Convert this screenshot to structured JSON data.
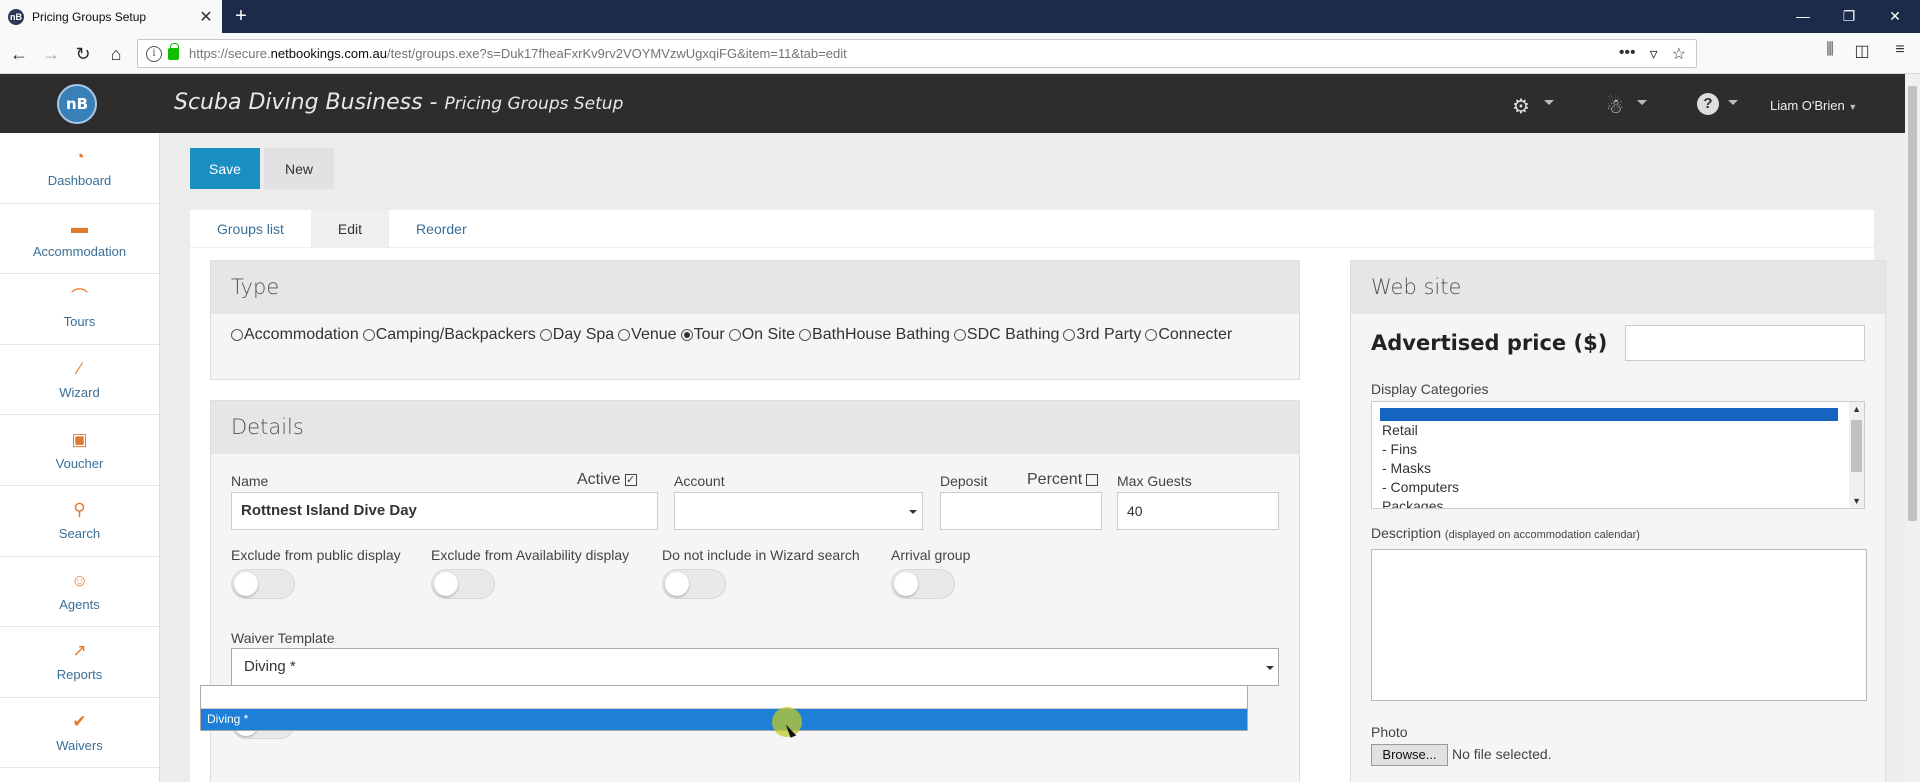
{
  "browser": {
    "tab_title": "Pricing Groups Setup",
    "tab_favicon": "nB",
    "url_prefix": "https://secure.",
    "url_domain": "netbookings.com.au",
    "url_path": "/test/groups.exe?s=Duk17fheaFxrKv9rv2VOYMVzwUgxqiFG&item=11&tab=edit"
  },
  "header": {
    "logo": "nB",
    "business": "Scuba Diving Business",
    "separator": " - ",
    "page": "Pricing Groups Setup",
    "user": "Liam O'Brien"
  },
  "sidebar": {
    "items": [
      {
        "label": "Dashboard",
        "icon": "dashboard-icon"
      },
      {
        "label": "Accommodation",
        "icon": "bed-icon"
      },
      {
        "label": "Tours",
        "icon": "hanger-icon"
      },
      {
        "label": "Wizard",
        "icon": "wand-icon"
      },
      {
        "label": "Voucher",
        "icon": "gift-icon"
      },
      {
        "label": "Search",
        "icon": "search-icon"
      },
      {
        "label": "Agents",
        "icon": "agent-icon"
      },
      {
        "label": "Reports",
        "icon": "chart-icon"
      },
      {
        "label": "Waivers",
        "icon": "check-icon"
      }
    ]
  },
  "toolbar": {
    "save": "Save",
    "new": "New"
  },
  "tabs": [
    "Groups list",
    "Edit",
    "Reorder"
  ],
  "type_box": {
    "title": "Type",
    "options": [
      "Accommodation",
      "Camping/Backpackers",
      "Day Spa",
      "Venue",
      "Tour",
      "On Site",
      "BathHouse Bathing",
      "SDC Bathing",
      "3rd Party",
      "Connecter"
    ],
    "selected": "Tour"
  },
  "details": {
    "title": "Details",
    "name_label": "Name",
    "name_value": "Rottnest Island Dive Day",
    "active_label": "Active",
    "active_checked": true,
    "account_label": "Account",
    "account_value": "",
    "deposit_label": "Deposit",
    "deposit_value": "",
    "percent_label": "Percent",
    "percent_checked": false,
    "max_guests_label": "Max Guests",
    "max_guests_value": "40",
    "toggles": [
      "Exclude from public display",
      "Exclude from Availability display",
      "Do not include in Wizard search",
      "Arrival group"
    ],
    "waiver_label": "Waiver Template",
    "waiver_value": "Diving *",
    "dropdown_option": "Diving *"
  },
  "website": {
    "title": "Web site",
    "advertised_label": "Advertised price ($)",
    "advertised_value": "",
    "categories_label": "Display Categories",
    "categories": [
      "Retail",
      "- Fins",
      "- Masks",
      "- Computers",
      "Packages"
    ],
    "description_label": "Description",
    "description_note": "(displayed on accommodation calendar)",
    "photo_label": "Photo",
    "browse_label": "Browse...",
    "no_file": "No file selected."
  }
}
